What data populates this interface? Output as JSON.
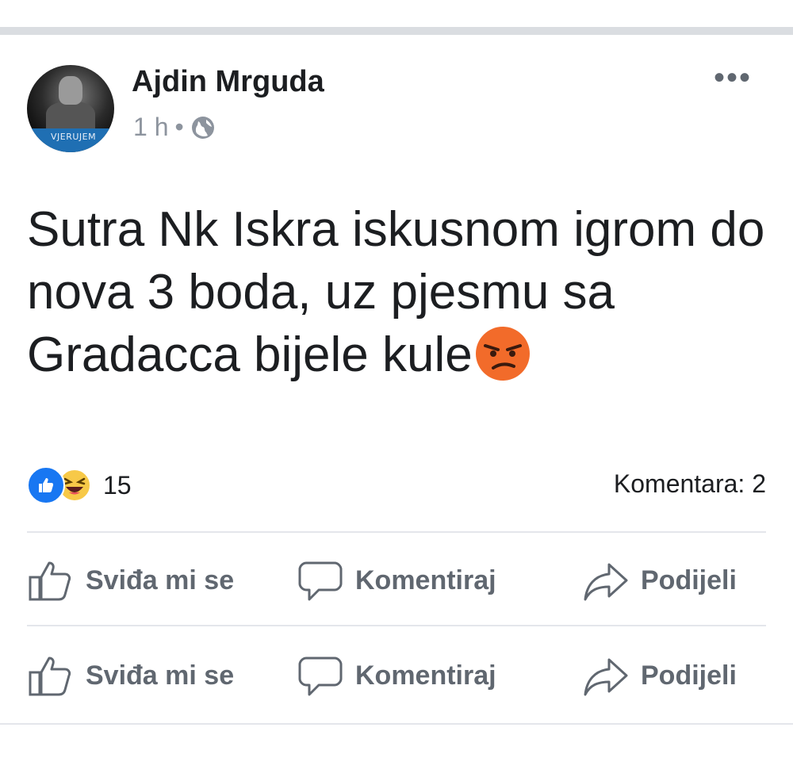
{
  "post": {
    "author": "Ajdin Mrguda",
    "time": "1 h",
    "separator": "•",
    "avatar_band_text": "VJERUJEM",
    "text": "Sutra Nk Iskra iskusnom igrom do nova 3 boda, uz pjesmu sa Gradacca bijele kule",
    "more_label": "•••"
  },
  "reactions": {
    "count": "15",
    "types": [
      "like-icon",
      "haha-emoji-icon"
    ],
    "comments_label": "Komentara: 2"
  },
  "actions": [
    {
      "label": "Sviđa mi se",
      "icon": "like-icon"
    },
    {
      "label": "Komentiraj",
      "icon": "comment-icon"
    },
    {
      "label": "Podijeli",
      "icon": "share-icon"
    }
  ],
  "actions_repeat": [
    {
      "label": "Sviđa mi se",
      "icon": "like-icon"
    },
    {
      "label": "Komentiraj",
      "icon": "comment-icon"
    },
    {
      "label": "Podijeli",
      "icon": "share-icon"
    }
  ],
  "colors": {
    "accent": "#1877f2",
    "text": "#1c1e21",
    "muted": "#606770",
    "divider": "#dadde1",
    "angry_emoji": "#f26b2a"
  }
}
